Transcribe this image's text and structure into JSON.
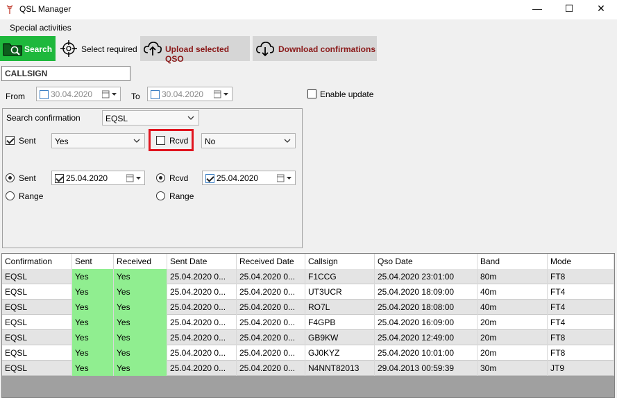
{
  "window": {
    "title": "QSL Manager",
    "minimize": "—",
    "maximize": "☐",
    "close": "✕"
  },
  "menu": {
    "special_activities": "Special activities"
  },
  "toolbar": {
    "search_label": "Search",
    "select_required_label": "Select required",
    "upload_label": "Upload selected QSO",
    "download_label": "Download confirmations"
  },
  "filter": {
    "callsign_value": "CALLSIGN",
    "from_label": "From",
    "from_date": "30.04.2020",
    "to_label": "To",
    "to_date": "30.04.2020",
    "enable_update_label": "Enable update"
  },
  "search_group": {
    "search_confirmation_label": "Search confirmation",
    "search_confirmation_value": "EQSL",
    "sent_check_label": "Sent",
    "sent_value": "Yes",
    "rcvd_check_label": "Rcvd",
    "rcvd_value": "No",
    "sent_radio_label": "Sent",
    "sent_date": "25.04.2020",
    "rcvd_radio_label": "Rcvd",
    "rcvd_date": "25.04.2020",
    "range_label_1": "Range",
    "range_label_2": "Range"
  },
  "table": {
    "columns": [
      "Confirmation",
      "Sent",
      "Received",
      "Sent Date",
      "Received Date",
      "Callsign",
      "Qso Date",
      "Band",
      "Mode"
    ],
    "rows": [
      [
        "EQSL",
        "Yes",
        "Yes",
        "25.04.2020 0...",
        "25.04.2020 0...",
        "F1CCG",
        "25.04.2020 23:01:00",
        "80m",
        "FT8"
      ],
      [
        "EQSL",
        "Yes",
        "Yes",
        "25.04.2020 0...",
        "25.04.2020 0...",
        "UT3UCR",
        "25.04.2020 18:09:00",
        "40m",
        "FT4"
      ],
      [
        "EQSL",
        "Yes",
        "Yes",
        "25.04.2020 0...",
        "25.04.2020 0...",
        "RO7L",
        "25.04.2020 18:08:00",
        "40m",
        "FT4"
      ],
      [
        "EQSL",
        "Yes",
        "Yes",
        "25.04.2020 0...",
        "25.04.2020 0...",
        "F4GPB",
        "25.04.2020 16:09:00",
        "20m",
        "FT4"
      ],
      [
        "EQSL",
        "Yes",
        "Yes",
        "25.04.2020 0...",
        "25.04.2020 0...",
        "GB9KW",
        "25.04.2020 12:49:00",
        "20m",
        "FT8"
      ],
      [
        "EQSL",
        "Yes",
        "Yes",
        "25.04.2020 0...",
        "25.04.2020 0...",
        "GJ0KYZ",
        "25.04.2020 10:01:00",
        "20m",
        "FT8"
      ],
      [
        "EQSL",
        "Yes",
        "Yes",
        "25.04.2020 0...",
        "25.04.2020 0...",
        "N4NNT82013",
        "29.04.2013 00:59:39",
        "30m",
        "JT9"
      ]
    ]
  },
  "colors": {
    "search_button": "#1eb83c",
    "action_text": "#8b1a1a",
    "highlight_border": "#e0141e",
    "yes_cell": "#90ee90"
  },
  "icons": {
    "app": "antenna-icon",
    "search": "folder-search-icon",
    "select_required": "crosshair-icon",
    "upload": "cloud-upload-icon",
    "download": "cloud-download-icon"
  }
}
